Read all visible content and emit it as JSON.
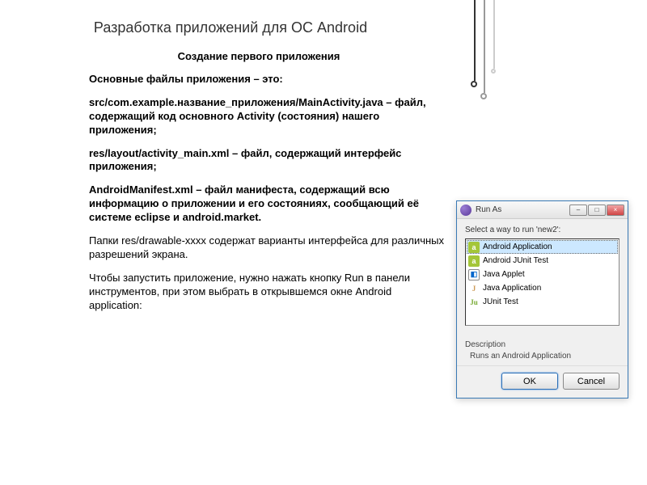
{
  "title": "Разработка приложений для ОС Android",
  "subtitle": "Создание первого приложения",
  "p1": "Основные файлы приложения – это:",
  "p2a": "src/com.example.название_приложения/MainActivity.java",
  "p2b": " – файл, содержащий код основного Activity (состояния) нашего приложения;",
  "p3a": "res/layout/activity_main.xml",
  "p3b": " – файл, содержащий интерфейс приложения;",
  "p4a": "AndroidManifest.xml",
  "p4b": " – файл манифеста, содержащий всю информацию о приложении и его состояниях, сообщающий её системе eclipse и android.market.",
  "p5": "Папки res/drawable-xxxx содержат варианты интерфейса для различных разрешений экрана.",
  "p6": "Чтобы запустить приложение, нужно нажать кнопку Run в панели инструментов, при этом выбрать в открывшемся окне Android application:",
  "dialog": {
    "title": "Run As",
    "prompt": "Select a way to run 'new2':",
    "items": [
      {
        "label": "Android Application",
        "iconClass": "ic-android",
        "glyph": "a",
        "selected": true
      },
      {
        "label": "Android JUnit Test",
        "iconClass": "ic-android",
        "glyph": "a",
        "selected": false
      },
      {
        "label": "Java Applet",
        "iconClass": "ic-applet",
        "glyph": "◧",
        "selected": false
      },
      {
        "label": "Java Application",
        "iconClass": "ic-java",
        "glyph": "J",
        "selected": false
      },
      {
        "label": "JUnit Test",
        "iconClass": "ic-junit",
        "glyph": "Ju",
        "selected": false
      }
    ],
    "descTitle": "Description",
    "descText": "Runs an Android Application",
    "ok": "OK",
    "cancel": "Cancel"
  }
}
